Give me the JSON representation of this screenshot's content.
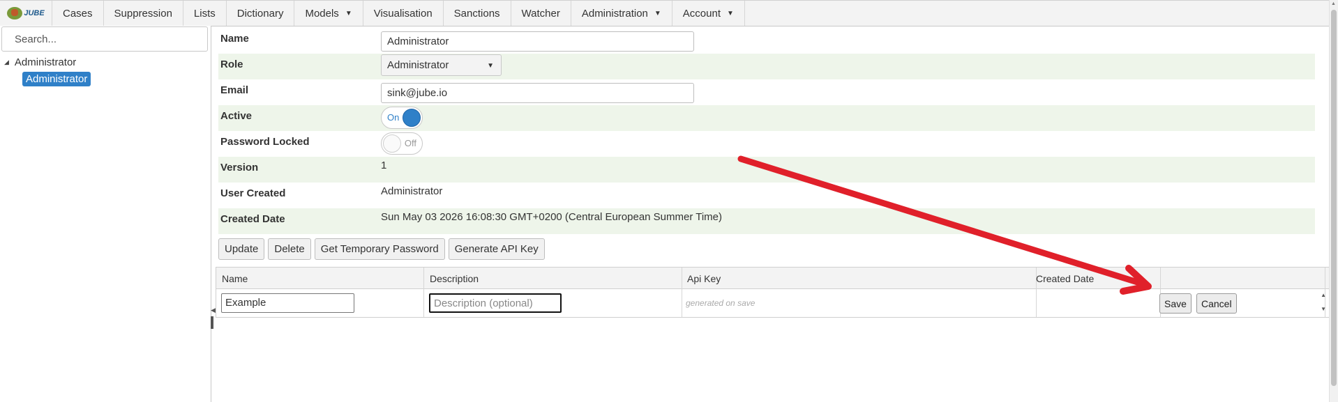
{
  "logo": {
    "text": "JUBE"
  },
  "menu": {
    "items": [
      {
        "label": "Cases",
        "dropdown": false
      },
      {
        "label": "Suppression",
        "dropdown": false
      },
      {
        "label": "Lists",
        "dropdown": false
      },
      {
        "label": "Dictionary",
        "dropdown": false
      },
      {
        "label": "Models",
        "dropdown": true
      },
      {
        "label": "Visualisation",
        "dropdown": false
      },
      {
        "label": "Sanctions",
        "dropdown": false
      },
      {
        "label": "Watcher",
        "dropdown": false
      },
      {
        "label": "Administration",
        "dropdown": true
      },
      {
        "label": "Account",
        "dropdown": true
      }
    ]
  },
  "sidebar": {
    "search_placeholder": "Search...",
    "tree": {
      "parent": "Administrator",
      "child": "Administrator"
    }
  },
  "form": {
    "name": {
      "label": "Name",
      "value": "Administrator"
    },
    "role": {
      "label": "Role",
      "value": "Administrator"
    },
    "email": {
      "label": "Email",
      "value": "sink@jube.io"
    },
    "active": {
      "label": "Active",
      "state": "On"
    },
    "password_locked": {
      "label": "Password Locked",
      "state": "Off"
    },
    "version": {
      "label": "Version",
      "value": "1"
    },
    "user_created": {
      "label": "User Created",
      "value": "Administrator"
    },
    "created_date": {
      "label": "Created Date",
      "value": "Sun May 03 2026 16:08:30 GMT+0200 (Central European Summer Time)"
    }
  },
  "actions": {
    "update": "Update",
    "delete": "Delete",
    "temp_password": "Get Temporary Password",
    "api_key": "Generate API Key"
  },
  "grid": {
    "headers": {
      "name": "Name",
      "description": "Description",
      "api_key": "Api Key",
      "created_date": "Created Date"
    },
    "new_row": {
      "name": "Example",
      "description_placeholder": "Description (optional)",
      "api_key_hint": "generated on save",
      "save": "Save",
      "cancel": "Cancel"
    }
  },
  "colors": {
    "accent": "#2f80c8",
    "row_shade": "#eef5ea",
    "annotation_arrow": "#e0202a"
  }
}
